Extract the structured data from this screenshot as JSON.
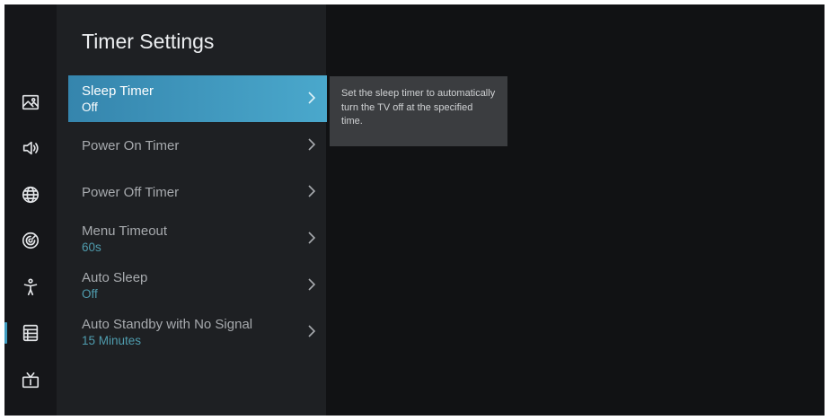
{
  "menu": {
    "title": "Timer Settings",
    "items": [
      {
        "label": "Sleep Timer",
        "value": "Off"
      },
      {
        "label": "Power On Timer",
        "value": ""
      },
      {
        "label": "Power Off Timer",
        "value": ""
      },
      {
        "label": "Menu Timeout",
        "value": "60s"
      },
      {
        "label": "Auto Sleep",
        "value": "Off"
      },
      {
        "label": "Auto Standby with No Signal",
        "value": "15 Minutes"
      }
    ],
    "selected_index": 0
  },
  "help": {
    "text": "Set the sleep timer to automatically turn the TV off at the specified time."
  },
  "sidebar": {
    "icons": [
      "picture-icon",
      "sound-icon",
      "network-icon",
      "accessibility-icon",
      "person-icon",
      "system-icon",
      "tv-icon"
    ],
    "selected_index": 5
  },
  "colors": {
    "background": "#111214",
    "panel": "#1e2023",
    "highlight_start": "#3585ad",
    "highlight_end": "#4aa8cc",
    "value_text": "#4f9cae",
    "help_box": "#3b3d40"
  }
}
